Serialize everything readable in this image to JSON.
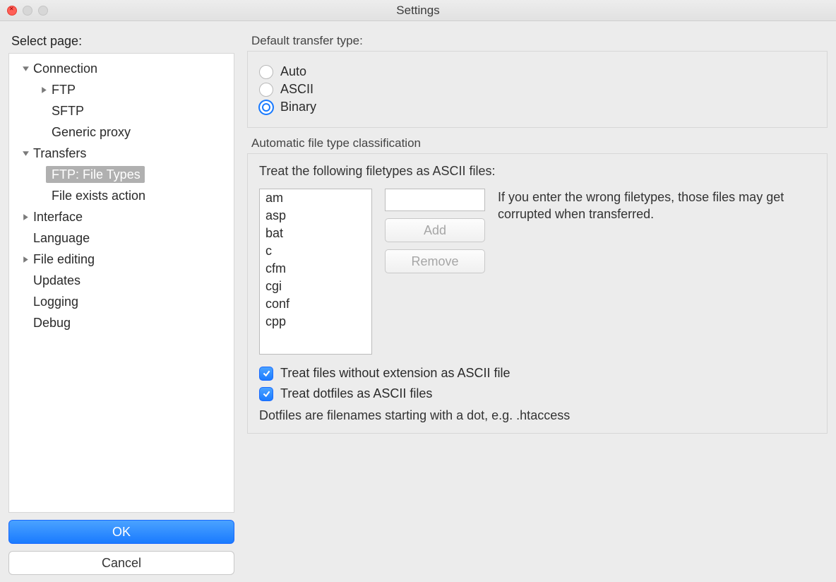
{
  "window": {
    "title": "Settings"
  },
  "sidebar": {
    "label": "Select page:",
    "tree": {
      "connection": {
        "label": "Connection",
        "expanded": true,
        "ftp": "FTP",
        "sftp": "SFTP",
        "generic_proxy": "Generic proxy"
      },
      "transfers": {
        "label": "Transfers",
        "expanded": true,
        "ftp_file_types": "FTP: File Types",
        "file_exists": "File exists action"
      },
      "interface": {
        "label": "Interface",
        "expanded": false
      },
      "language": {
        "label": "Language"
      },
      "file_editing": {
        "label": "File editing",
        "expanded": false
      },
      "updates": {
        "label": "Updates"
      },
      "logging": {
        "label": "Logging"
      },
      "debug": {
        "label": "Debug"
      }
    },
    "ok": "OK",
    "cancel": "Cancel"
  },
  "main": {
    "default_transfer": {
      "title": "Default transfer type:",
      "auto": "Auto",
      "ascii": "ASCII",
      "binary": "Binary",
      "selected": "binary"
    },
    "auto_classification": {
      "title": "Automatic file type classification",
      "treat_label": "Treat the following filetypes as ASCII files:",
      "filetypes": [
        "am",
        "asp",
        "bat",
        "c",
        "cfm",
        "cgi",
        "conf",
        "cpp"
      ],
      "new_value": "",
      "add": "Add",
      "remove": "Remove",
      "warning": "If you enter the wrong filetypes, those files may get corrupted when transferred.",
      "treat_noext": {
        "checked": true,
        "label": "Treat files without extension as ASCII file"
      },
      "treat_dotfiles": {
        "checked": true,
        "label": "Treat dotfiles as ASCII files"
      },
      "dotfiles_note": "Dotfiles are filenames starting with a dot, e.g. .htaccess"
    }
  }
}
